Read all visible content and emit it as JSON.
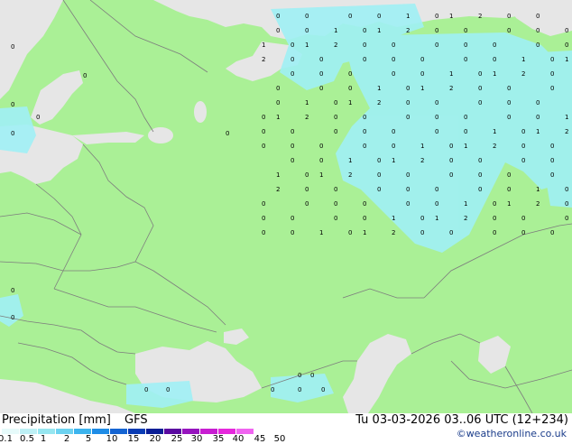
{
  "legend": {
    "title": "Precipitation [mm]",
    "model": "GFS",
    "time": "Tu 03-03-2026 03..06 UTC (12+234)",
    "credit": "©weatheronline.co.uk",
    "scale_labels": [
      "0.1",
      "0.5",
      "1",
      "2",
      "5",
      "10",
      "15",
      "20",
      "25",
      "30",
      "35",
      "40",
      "45",
      "50"
    ],
    "scale_colors": [
      "#e6fafa",
      "#bdf0f5",
      "#96e6f0",
      "#6cd2f0",
      "#3cb4ee",
      "#1e8ce6",
      "#1464d2",
      "#0a3cb4",
      "#0a1e96",
      "#5a0aa0",
      "#9614be",
      "#c81ed2",
      "#e628dc",
      "#f064f0"
    ]
  },
  "map": {
    "land_color": "#aaf096",
    "sea_color": "#e6e6e6",
    "precip_color": "#a0f0f5",
    "border_color": "#7d7d7d",
    "markers": [
      "0",
      "1",
      "2"
    ]
  }
}
